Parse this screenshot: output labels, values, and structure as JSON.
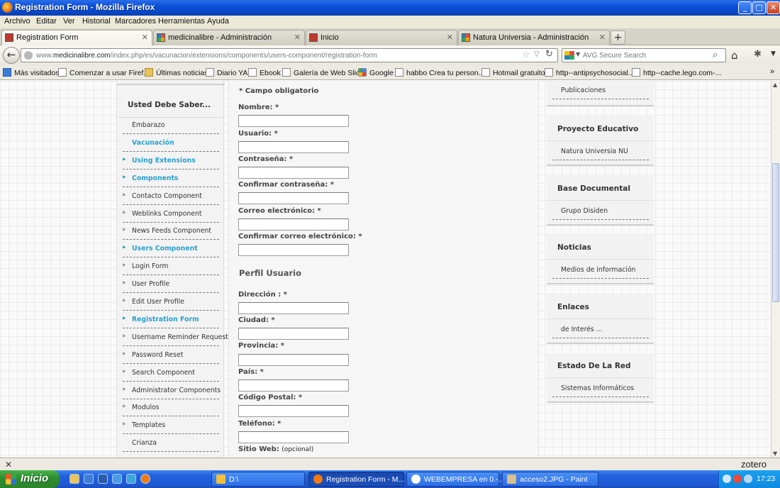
{
  "window": {
    "title": "Registration Form - Mozilla Firefox",
    "min": "_",
    "max": "□",
    "close": "✕"
  },
  "menu": [
    "Archivo",
    "Editar",
    "Ver",
    "Historial",
    "Marcadores",
    "Herramientas",
    "Ayuda"
  ],
  "tabs": [
    {
      "label": "Registration Form",
      "close": "✕"
    },
    {
      "label": "medicinalibre - Administración",
      "close": "✕"
    },
    {
      "label": "Inicio",
      "close": "✕"
    },
    {
      "label": "Natura Universia - Administración",
      "close": "✕"
    }
  ],
  "new_tab": "+",
  "nav": {
    "back": "←",
    "url_prefix": "www.",
    "url_domain": "medicinalibre.com",
    "url_path": "/index.php/es/vacunacion/extensions/components/users-component/registration-form",
    "star": "☆",
    "dropdown": "▽",
    "reload": "↻",
    "search_placeholder": "AVG Secure Search",
    "search_arrow": "▼",
    "search_go": "⌕",
    "home": "⌂",
    "addon": "✱",
    "more": "▼"
  },
  "bookmarks": [
    "Más visitados",
    "Comenzar a usar Firef...",
    "Últimas noticias",
    "Diario YA",
    "Ebook",
    "Galería de Web Slice",
    "Google",
    "habbo Crea tu person...",
    "Hotmail gratuito",
    "http--antipsychosocial...",
    "http--cache.lego.com-..."
  ],
  "bookmarks_more": "»",
  "left": {
    "heading": "Usted Debe Saber...",
    "items": [
      {
        "label": "Embarazo",
        "hl": false,
        "bullet": false
      },
      {
        "label": "Vacunación",
        "hl": true,
        "bullet": false
      },
      {
        "label": "Using Extensions",
        "hl": true,
        "bullet": true
      },
      {
        "label": "Components",
        "hl": true,
        "bullet": true
      },
      {
        "label": "Contacto Component",
        "hl": false,
        "bullet": true
      },
      {
        "label": "Weblinks Component",
        "hl": false,
        "bullet": true
      },
      {
        "label": "News Feeds Component",
        "hl": false,
        "bullet": true
      },
      {
        "label": "Users Component",
        "hl": true,
        "bullet": true
      },
      {
        "label": "Login Form",
        "hl": false,
        "bullet": true
      },
      {
        "label": "User Profile",
        "hl": false,
        "bullet": true
      },
      {
        "label": "Edit User Profile",
        "hl": false,
        "bullet": true
      },
      {
        "label": "Registration Form",
        "hl": true,
        "bullet": true
      },
      {
        "label": "Username Reminder Request",
        "hl": false,
        "bullet": true
      },
      {
        "label": "Password Reset",
        "hl": false,
        "bullet": true
      },
      {
        "label": "Search Component",
        "hl": false,
        "bullet": true
      },
      {
        "label": "Administrator Components",
        "hl": false,
        "bullet": true
      },
      {
        "label": "Modulos",
        "hl": false,
        "bullet": true
      },
      {
        "label": "Templates",
        "hl": false,
        "bullet": true
      },
      {
        "label": "Crianza",
        "hl": false,
        "bullet": false
      }
    ]
  },
  "form": {
    "required_note": "* Campo obligatorio",
    "fields": [
      {
        "label": "Nombre: *",
        "value": ""
      },
      {
        "label": "Usuario: *",
        "value": ""
      },
      {
        "label": "Contraseña: *",
        "value": ""
      },
      {
        "label": "Confirmar contraseña: *",
        "value": ""
      },
      {
        "label": "Correo electrónico: *",
        "value": ""
      },
      {
        "label": "Confirmar correo electrónico: *",
        "value": ""
      }
    ],
    "profile_heading": "Perfil Usuario",
    "profile_fields": [
      {
        "label": "Dirección : *",
        "value": ""
      },
      {
        "label": "Ciudad: *",
        "value": ""
      },
      {
        "label": "Provincia: *",
        "value": ""
      },
      {
        "label": "País: *",
        "value": ""
      },
      {
        "label": "Código Postal: *",
        "value": ""
      },
      {
        "label": "Teléfono: *",
        "value": ""
      }
    ],
    "website_label": "Sitio Web:",
    "website_optional": "(opcional)"
  },
  "right": {
    "top_item": "Publicaciones",
    "blocks": [
      {
        "title": "Proyecto Educativo",
        "item": "Natura Universia NU"
      },
      {
        "title": "Base Documental",
        "item": "Grupo Disiden"
      },
      {
        "title": "Noticias",
        "item": "Medios de información"
      },
      {
        "title": "Enlaces",
        "item": "de Interés ..."
      },
      {
        "title": "Estado De La Red",
        "item": "Sistemas Informáticos"
      }
    ]
  },
  "status": {
    "close": "✕",
    "zotero": "zotero"
  },
  "taskbar": {
    "start": "Inicio",
    "buttons": [
      {
        "label": "D:\\",
        "active": false
      },
      {
        "label": "Registration Form - M...",
        "active": true
      },
      {
        "label": "WEBEMPRESA en 0.-...",
        "active": false
      },
      {
        "label": "acceso2.JPG - Paint",
        "active": false
      }
    ],
    "clock": "17:23"
  },
  "scroll": {
    "up": "▲",
    "down": "▼"
  }
}
